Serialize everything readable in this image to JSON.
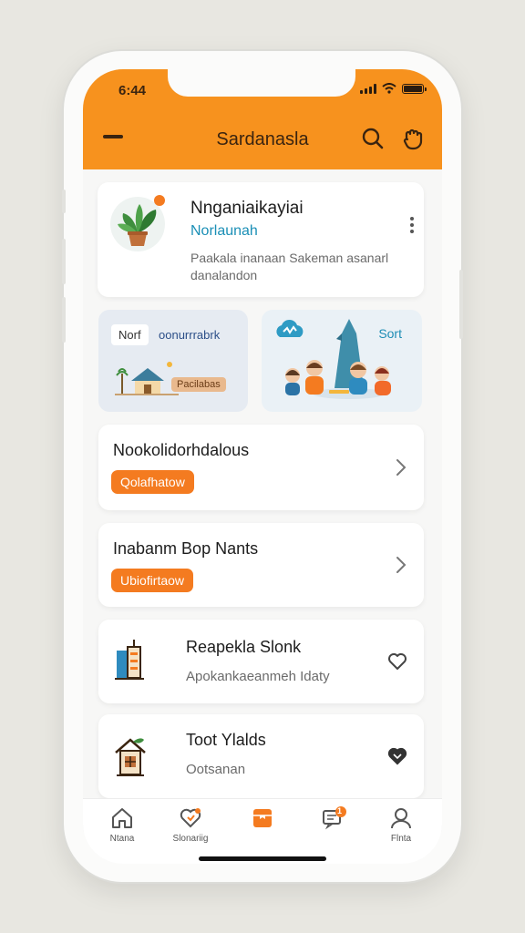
{
  "status_bar": {
    "time": "6:44"
  },
  "header": {
    "title": "Sardanasla",
    "menu_icon": "menu-icon",
    "search_icon": "search-icon",
    "action_icon": "hand-icon",
    "bg_color": "#f7921e"
  },
  "profile": {
    "name": "Nnganiaikayiai",
    "subtitle": "Norlaunah",
    "description": "Paakala inanaan Sakeman asanarl danalandon",
    "more_icon": "more-vertical-icon"
  },
  "banners": [
    {
      "chip": "Norf",
      "text": "oonurrrabrk",
      "pill": "Pacilabas"
    },
    {
      "label": "Sort"
    }
  ],
  "list": [
    {
      "title": "Nookolidorhdalous",
      "pill": "Qolafhatow"
    },
    {
      "title": "Inabanm Bop Nants",
      "pill": "Ubiofirtaow"
    }
  ],
  "items": [
    {
      "title": "Reapekla Slonk",
      "subtitle": "Apokankaeanmeh Idaty",
      "icon": "building-icon",
      "action_icon": "heart-icon"
    },
    {
      "title": "Toot Ylalds",
      "subtitle": "Ootsanan",
      "icon": "house-icon",
      "action_icon": "heart-icon"
    }
  ],
  "tabs": [
    {
      "label": "Ntana",
      "icon": "home-icon"
    },
    {
      "label": "Slonariig",
      "icon": "heart-tag-icon"
    },
    {
      "label": "",
      "icon": "box-icon",
      "active": true
    },
    {
      "label": "",
      "icon": "message-icon",
      "badge": "1"
    },
    {
      "label": "Flnta",
      "icon": "user-icon"
    }
  ],
  "accent_color": "#f47b20",
  "link_color": "#1b8fb6"
}
